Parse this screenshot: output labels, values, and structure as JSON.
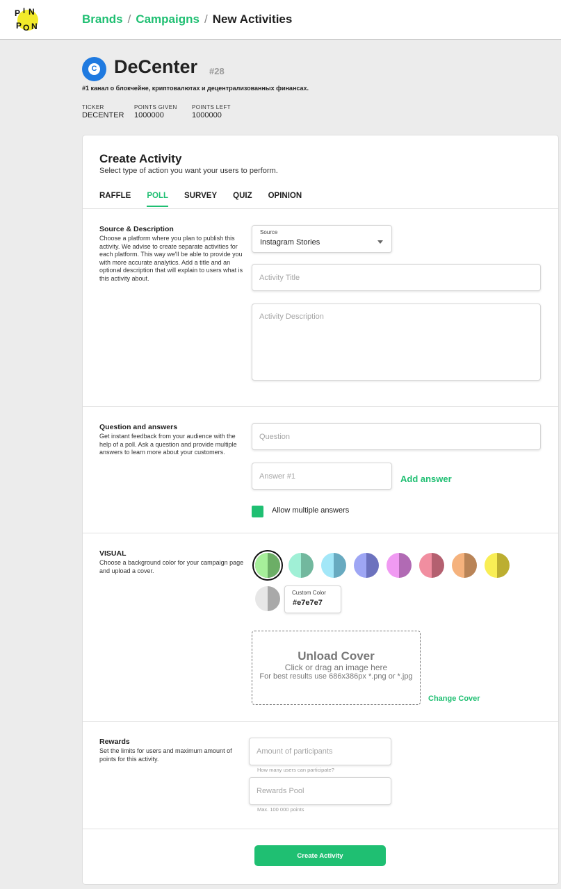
{
  "header": {
    "logo_alt": "PINPON",
    "breadcrumb": {
      "brands": "Brands",
      "campaigns": "Campaigns",
      "current": "New Activities",
      "sep": "/"
    }
  },
  "brand": {
    "avatar_letter": "C",
    "name": "DeCenter",
    "number": "#28",
    "description": "#1 канал о блокчейне, криптовалютах и децентрализованных финансах.",
    "stats": [
      {
        "label": "TICKER",
        "value": "DECENTER"
      },
      {
        "label": "POINTS GIVEN",
        "value": "1000000"
      },
      {
        "label": "POINTS LEFT",
        "value": "1000000"
      }
    ]
  },
  "create": {
    "title": "Create Activity",
    "subtitle": "Select type of action you want your users to perform.",
    "tabs": [
      "RAFFLE",
      "POLL",
      "SURVEY",
      "QUIZ",
      "OPINION"
    ],
    "active_tab": "POLL"
  },
  "source_section": {
    "title": "Source & Description",
    "description": "Choose a platform where you plan to publish this activity. We advise to create separate activities for each platform. This way we'll be able to provide you with more accurate analytics. Add a title and an optional description that will explain to users what is this activity about.",
    "source_label": "Source",
    "source_value": "Instagram Stories",
    "title_placeholder": "Activity Title",
    "description_placeholder": "Activity Description"
  },
  "question_section": {
    "title": "Question and answers",
    "description": "Get instant feedback from your audience with the help of a poll. Ask a question and provide multiple answers to learn more about your customers.",
    "question_placeholder": "Question",
    "answer_placeholder": "Answer #1",
    "add_answer": "Add answer",
    "multiple_label": "Allow multiple answers",
    "multiple_checked": true
  },
  "visual_section": {
    "title": "VISUAL",
    "description": "Choose a background color for your campaign page and upload a cover.",
    "swatches": [
      {
        "light": "#a6ef9a",
        "dark": "#6cae66",
        "selected": true
      },
      {
        "light": "#a0f0d6",
        "dark": "#72b89e"
      },
      {
        "light": "#a3e7f8",
        "dark": "#68aac0"
      },
      {
        "light": "#9ea6f4",
        "dark": "#6c72be"
      },
      {
        "light": "#f09af2",
        "dark": "#b16ab4"
      },
      {
        "light": "#f18ea0",
        "dark": "#b46070"
      },
      {
        "light": "#f5b27d",
        "dark": "#b98457"
      },
      {
        "light": "#f9ee55",
        "dark": "#bcae30"
      },
      {
        "light": "#e7e7e7",
        "dark": "#a9a9a9"
      }
    ],
    "custom_color_label": "Custom Color",
    "custom_color_value": "#e7e7e7",
    "upload_title": "Unload Cover",
    "upload_hint": "Click or drag an image here",
    "upload_hint2": "For best results use 686x386px *.png or *.jpg",
    "change_cover": "Change Cover"
  },
  "rewards_section": {
    "title": "Rewards",
    "description": "Set the limits for users and maximum amount of points for this activity.",
    "participants_placeholder": "Amount of participants",
    "participants_hint": "How many users can participate?",
    "pool_placeholder": "Rewards Pool",
    "pool_hint": "Max. 100 000 points"
  },
  "submit_label": "Create Activity"
}
